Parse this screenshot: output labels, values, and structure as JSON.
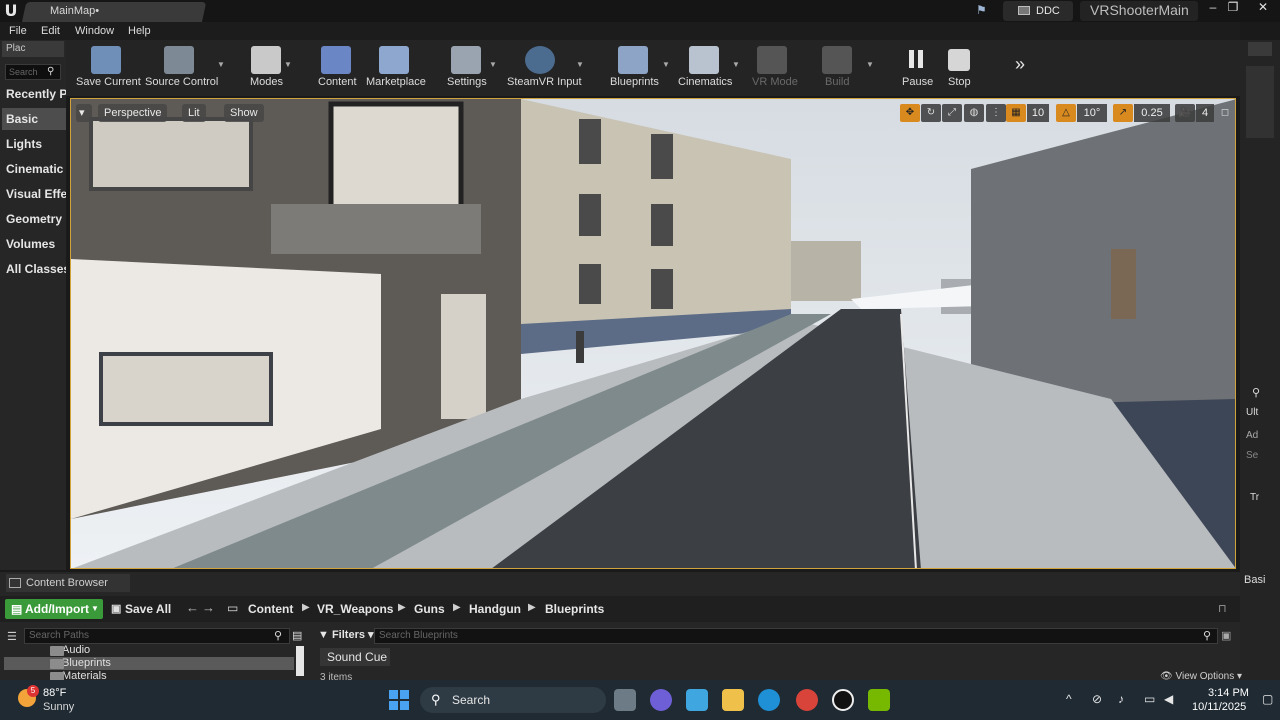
{
  "window": {
    "tab_title": "MainMap•",
    "ddc_label": "DDC",
    "project_name": "VRShooterMain",
    "minimize": "–",
    "maximize": "❐",
    "close": "✕"
  },
  "menu": {
    "items": [
      "File",
      "Edit",
      "Window",
      "Help"
    ]
  },
  "left_panel": {
    "tab_label": "Plac",
    "search_placeholder": "Search",
    "categories": [
      "Recently Pl",
      "Basic",
      "Lights",
      "Cinematic",
      "Visual Effe",
      "Geometry",
      "Volumes",
      "All Classes"
    ],
    "active_category": "Basic"
  },
  "toolbar": {
    "buttons": [
      {
        "label": "Save Current",
        "icon": "save-icon"
      },
      {
        "label": "Source Control",
        "icon": "source-control-icon"
      },
      {
        "label": "Modes",
        "icon": "modes-icon"
      },
      {
        "label": "Content",
        "icon": "content-icon"
      },
      {
        "label": "Marketplace",
        "icon": "marketplace-icon"
      },
      {
        "label": "Settings",
        "icon": "settings-icon"
      },
      {
        "label": "SteamVR Input",
        "icon": "steamvr-icon"
      },
      {
        "label": "Blueprints",
        "icon": "blueprints-icon"
      },
      {
        "label": "Cinematics",
        "icon": "cinematics-icon"
      },
      {
        "label": "VR Mode",
        "icon": "vr-mode-icon",
        "disabled": true
      },
      {
        "label": "Build",
        "icon": "build-icon",
        "disabled": true
      },
      {
        "label": "Pause",
        "icon": "pause-icon"
      },
      {
        "label": "Stop",
        "icon": "stop-icon"
      }
    ],
    "more": "»"
  },
  "viewport": {
    "perspective_label": "Perspective",
    "lit_label": "Lit",
    "show_label": "Show",
    "grid_snap": "10",
    "rotation_snap": "10°",
    "scale_snap": "0.25",
    "camera_speed": "4"
  },
  "content_browser": {
    "tab_label": "Content Browser",
    "add_import_label": "Add/Import",
    "save_all_label": "Save All",
    "breadcrumbs": [
      "Content",
      "VR_Weapons",
      "Guns",
      "Handgun",
      "Blueprints"
    ],
    "path_search_placeholder": "Search Paths",
    "filters_label": "Filters",
    "asset_search_placeholder": "Search Blueprints",
    "folders": [
      {
        "name": "Audio",
        "selected": false
      },
      {
        "name": "Blueprints",
        "selected": true
      },
      {
        "name": "Materials",
        "selected": false
      }
    ],
    "filter_chip": "Sound Cue",
    "items_count": "3 items",
    "view_options": "View Options"
  },
  "right_panel": {
    "labels": [
      "Ult",
      "Ad",
      "Se",
      "Tr",
      "Basi"
    ]
  },
  "taskbar": {
    "weather_badge": "5",
    "temperature": "88°F",
    "condition": "Sunny",
    "search_label": "Search",
    "time": "3:14 PM",
    "date": "10/11/2025",
    "apps": [
      "file-explorer-icon",
      "copilot-icon",
      "folder-icon",
      "edge-icon",
      "chrome-icon",
      "unreal-icon",
      "nvidia-icon"
    ]
  },
  "colors": {
    "viewport_border": "#d1a33c",
    "add_import": "#3a9a3a",
    "snap_active": "#d98a1e"
  }
}
